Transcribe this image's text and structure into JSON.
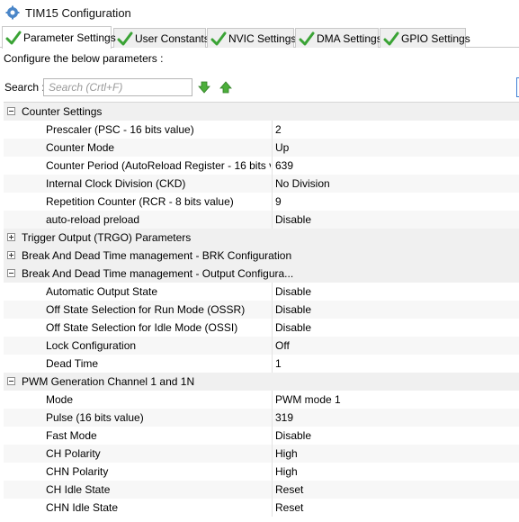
{
  "window": {
    "title": "TIM15 Configuration",
    "icon": "gear-icon"
  },
  "tabs": [
    {
      "label": "Parameter Settings",
      "icon": "green-check-icon",
      "active": true
    },
    {
      "label": "User Constants",
      "icon": "green-check-icon",
      "active": false
    },
    {
      "label": "NVIC Settings",
      "icon": "green-check-icon",
      "active": false
    },
    {
      "label": "DMA Settings",
      "icon": "green-check-icon",
      "active": false
    },
    {
      "label": "GPIO Settings",
      "icon": "green-check-icon",
      "active": false
    }
  ],
  "configure_label": "Configure the below parameters :",
  "search": {
    "label": "Search :",
    "placeholder": "Search (Crtl+F)",
    "value": "",
    "down_icon": "arrow-down-icon",
    "up_icon": "arrow-up-icon"
  },
  "groups": [
    {
      "label": "Counter Settings",
      "expanded": true,
      "params": [
        {
          "name": "Prescaler (PSC - 16 bits value)",
          "value": "2"
        },
        {
          "name": "Counter Mode",
          "value": "Up"
        },
        {
          "name": "Counter Period (AutoReload Register - 16 bits va...",
          "value": "639"
        },
        {
          "name": "Internal Clock Division (CKD)",
          "value": "No Division"
        },
        {
          "name": "Repetition Counter (RCR - 8 bits value)",
          "value": "9"
        },
        {
          "name": "auto-reload preload",
          "value": "Disable"
        }
      ]
    },
    {
      "label": "Trigger Output (TRGO) Parameters",
      "expanded": false,
      "params": []
    },
    {
      "label": "Break And Dead Time management - BRK Configuration",
      "expanded": false,
      "params": []
    },
    {
      "label": "Break And Dead Time management - Output Configura...",
      "expanded": true,
      "params": [
        {
          "name": "Automatic Output State",
          "value": "Disable"
        },
        {
          "name": "Off State Selection for Run Mode (OSSR)",
          "value": "Disable"
        },
        {
          "name": "Off State Selection for Idle Mode (OSSI)",
          "value": "Disable"
        },
        {
          "name": "Lock Configuration",
          "value": "Off"
        },
        {
          "name": "Dead Time",
          "value": "1"
        }
      ]
    },
    {
      "label": "PWM Generation Channel 1 and 1N",
      "expanded": true,
      "params": [
        {
          "name": "Mode",
          "value": "PWM mode 1"
        },
        {
          "name": "Pulse (16 bits value)",
          "value": "319"
        },
        {
          "name": "Fast Mode",
          "value": "Disable"
        },
        {
          "name": "CH Polarity",
          "value": "High"
        },
        {
          "name": "CHN Polarity",
          "value": "High"
        },
        {
          "name": "CH Idle State",
          "value": "Reset"
        },
        {
          "name": "CHN Idle State",
          "value": "Reset"
        }
      ]
    }
  ]
}
